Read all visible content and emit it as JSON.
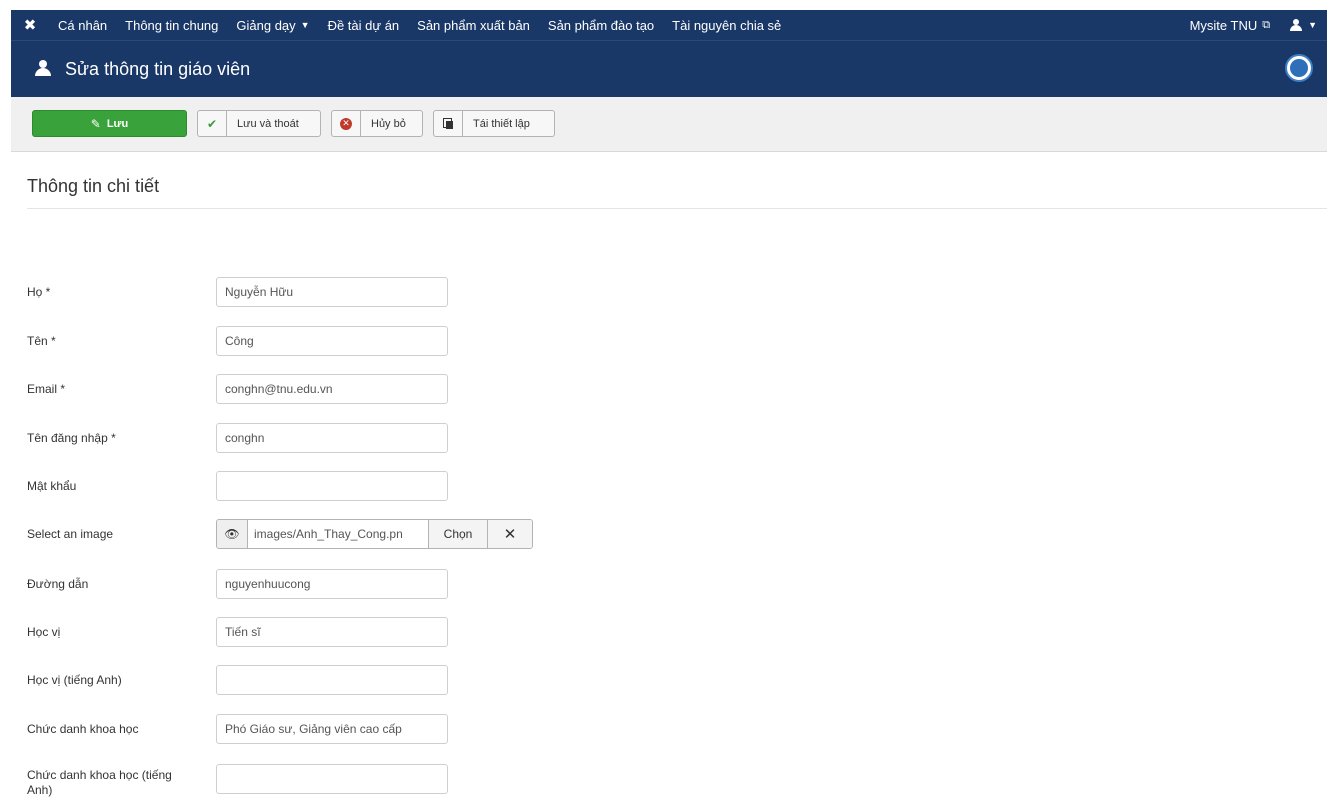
{
  "nav": {
    "items": [
      {
        "label": "Cá nhân",
        "caret": false
      },
      {
        "label": "Thông tin chung",
        "caret": false
      },
      {
        "label": "Giảng dạy",
        "caret": true
      },
      {
        "label": "Đề tài dự án",
        "caret": false
      },
      {
        "label": "Sản phẩm xuất bản",
        "caret": false
      },
      {
        "label": "Sản phẩm đào tạo",
        "caret": false
      },
      {
        "label": "Tài nguyên chia sẻ",
        "caret": false
      }
    ],
    "site_link": "Mysite TNU",
    "brand_icon": "joomla-icon",
    "user_icon": "user-icon"
  },
  "header": {
    "title": "Sửa thông tin giáo viên",
    "icon": "user-icon"
  },
  "toolbar": {
    "save_label": "Lưu",
    "save_close_label": "Lưu và thoát",
    "cancel_label": "Hủy bỏ",
    "reset_label": "Tái thiết lập"
  },
  "section": {
    "title": "Thông tin chi tiết"
  },
  "form": {
    "fields": [
      {
        "label": "Họ *",
        "value": "Nguyễn Hữu"
      },
      {
        "label": "Tên *",
        "value": "Công"
      },
      {
        "label": "Email *",
        "value": "conghn@tnu.edu.vn"
      },
      {
        "label": "Tên đăng nhập *",
        "value": "conghn"
      },
      {
        "label": "Mật khẩu",
        "value": ""
      },
      {
        "label": "Select an image",
        "value": "images/Anh_Thay_Cong.pn",
        "choose_label": "Chọn"
      },
      {
        "label": "Đường dẫn",
        "value": "nguyenhuucong"
      },
      {
        "label": "Học vị",
        "value": "Tiến sĩ"
      },
      {
        "label": "Học vị (tiếng Anh)",
        "value": ""
      },
      {
        "label": "Chức danh khoa học",
        "value": "Phó Giáo sư, Giảng viên cao cấp"
      },
      {
        "label": "Chức danh khoa học (tiếng Anh)",
        "value": ""
      }
    ]
  },
  "colors": {
    "nav_bg": "#1a3867",
    "save_green": "#3aa23a",
    "cancel_red": "#c0392b"
  }
}
